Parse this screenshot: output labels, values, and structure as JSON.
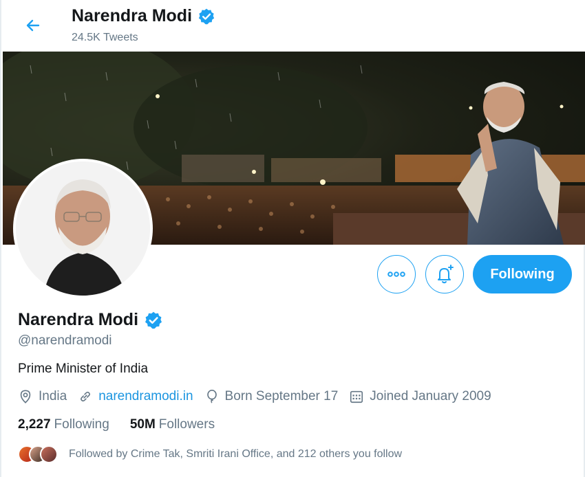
{
  "header": {
    "name": "Narendra Modi",
    "tweet_count": "24.5K Tweets"
  },
  "profile": {
    "name": "Narendra Modi",
    "handle": "@narendramodi",
    "bio": "Prime Minister of India",
    "location": "India",
    "website": "narendramodi.in",
    "birthday": "Born September 17",
    "joined": "Joined January 2009"
  },
  "stats": {
    "following_count": "2,227",
    "following_label": "Following",
    "followers_count": "50M",
    "followers_label": "Followers"
  },
  "followed_by": "Followed by Crime Tak, Smriti Irani Office, and 212 others you follow",
  "actions": {
    "following_label": "Following"
  },
  "icons": {
    "back": "arrow-left-icon",
    "verified": "verified-badge-icon",
    "more": "more-icon",
    "notify": "bell-plus-icon",
    "location": "location-pin-icon",
    "link": "link-icon",
    "birthday": "balloon-icon",
    "calendar": "calendar-icon"
  },
  "colors": {
    "accent": "#1da1f2",
    "link": "#1b95e0",
    "secondary_text": "#657786",
    "primary_text": "#14171a"
  }
}
